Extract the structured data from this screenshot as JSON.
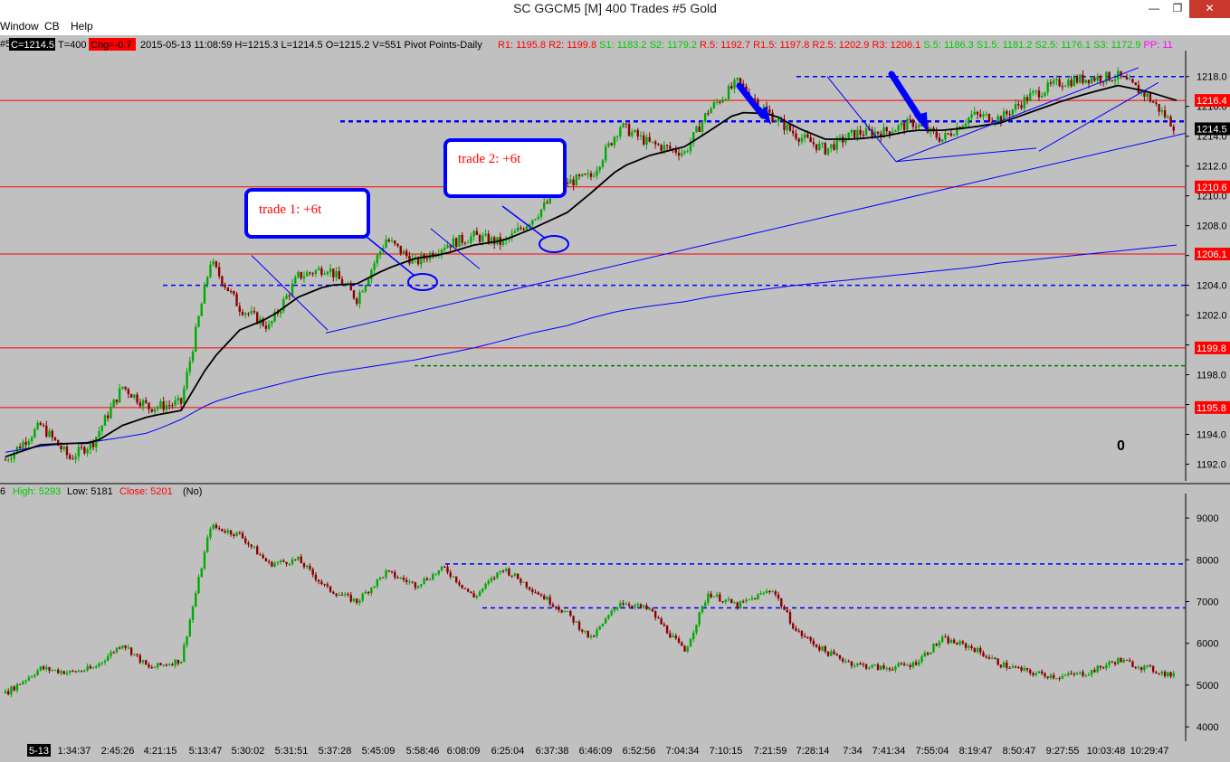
{
  "window": {
    "title": "SC GGCM5 [M]  400 Trades  #5  Gold",
    "minimize_glyph": "—",
    "restore_glyph": "❐",
    "close_glyph": "✕"
  },
  "menu": {
    "items": [
      "Window",
      "CB",
      "Help"
    ]
  },
  "info_bar": {
    "chart_no": "#5",
    "last_box": "C=1214.5",
    "trades": "T=400",
    "change_box": "Chg=-0.7",
    "bar_text": "2015-05-13 11:08:59 H=1215.3 L=1214.5 O=1215.2 V=551 Pivot Points-Daily",
    "pivots": [
      {
        "text": "R1: 1195.8",
        "color": "#ff0000"
      },
      {
        "text": "R2: 1199.8",
        "color": "#ff0000"
      },
      {
        "text": "S1: 1183.2",
        "color": "#00cc00"
      },
      {
        "text": "S2: 1179.2",
        "color": "#00cc00"
      },
      {
        "text": "R.5: 1192.7",
        "color": "#ff0000"
      },
      {
        "text": "R1.5: 1197.8",
        "color": "#ff0000"
      },
      {
        "text": "R2.5: 1202.9",
        "color": "#ff0000"
      },
      {
        "text": "R3: 1206.1",
        "color": "#ff0000"
      },
      {
        "text": "S.5: 1186.3",
        "color": "#00cc00"
      },
      {
        "text": "S1.5: 1181.2",
        "color": "#00cc00"
      },
      {
        "text": "S2.5: 1176.1",
        "color": "#00cc00"
      },
      {
        "text": "S3: 1172.9",
        "color": "#00cc00"
      },
      {
        "text": "PP: 11",
        "color": "#ff00ff"
      }
    ]
  },
  "colors": {
    "background": "#c0c0c0",
    "up_candle": "#00aa00",
    "down_candle": "#8b0000",
    "level_line": "#ff0000",
    "dashed_blue": "#0000ff",
    "ma_line": "#000000",
    "slow_ma": "#0000ff",
    "annotation_border": "#0000ff",
    "annotation_text": "#ff0000"
  },
  "annotations": {
    "trade1": "trade 1: +6t",
    "trade2": "trade 2: +6t",
    "counter": "0"
  },
  "lower_panel": {
    "prefix": "6",
    "high_text": "High: 5293",
    "low_text": "Low: 5181",
    "close_text": "Close: 5201",
    "no_text": "(No)"
  },
  "chart_data": [
    {
      "type": "candlestick",
      "name": "GGCM5 400 Trades",
      "ylim": [
        1191,
        1219.5
      ],
      "y_ticks": [
        "1218.0",
        "1216.0",
        "1214.0",
        "1212.0",
        "1210.0",
        "1208.0",
        "1206.0",
        "1204.0",
        "1202.0",
        "1200.0",
        "1198.0",
        "1196.0",
        "1194.0",
        "1192.0"
      ],
      "price_levels": [
        {
          "label": "1216.4",
          "value": 1216.4
        },
        {
          "label": "1210.6",
          "value": 1210.6
        },
        {
          "label": "1206.1",
          "value": 1206.1
        },
        {
          "label": "1199.8",
          "value": 1199.8
        },
        {
          "label": "1195.8",
          "value": 1195.8
        }
      ],
      "current_price": "1214.5",
      "dashed_levels": [
        1218.0,
        1215.0,
        1204.0
      ],
      "green_dashed_level": 1198.6,
      "path_x_index": [
        0,
        12,
        22,
        30,
        40,
        49,
        60,
        70,
        80,
        90,
        100,
        110,
        120,
        130,
        140,
        150,
        160,
        170,
        180,
        192,
        200,
        210,
        220,
        232,
        240,
        250,
        262,
        270,
        280,
        290,
        300,
        310,
        320,
        330,
        340,
        350,
        360,
        370,
        380,
        390,
        400
      ],
      "path_close": [
        1192.3,
        1194.6,
        1192.4,
        1193.5,
        1197.2,
        1195.8,
        1196.1,
        1205.6,
        1202.5,
        1201.2,
        1204.6,
        1205.2,
        1203.1,
        1207.1,
        1205.5,
        1206.7,
        1207.3,
        1206.8,
        1208.5,
        1210.9,
        1211.3,
        1214.7,
        1213.5,
        1212.9,
        1215.7,
        1217.6,
        1215.3,
        1214.1,
        1213.1,
        1214.2,
        1214.3,
        1214.9,
        1213.8,
        1215.4,
        1215.2,
        1216.7,
        1217.6,
        1217.9,
        1218.0,
        1216.7,
        1214.5
      ],
      "fast_ma": [
        1192.5,
        1193.3,
        1193.4,
        1193.4,
        1194.6,
        1195.2,
        1195.6,
        1198.9,
        1201.0,
        1201.8,
        1203.2,
        1204.0,
        1204.1,
        1205.1,
        1205.8,
        1206.1,
        1206.7,
        1207.0,
        1207.8,
        1208.9,
        1210.2,
        1211.9,
        1212.7,
        1213.3,
        1214.3,
        1215.6,
        1215.5,
        1214.6,
        1213.8,
        1213.8,
        1214.0,
        1214.4,
        1214.4,
        1214.6,
        1214.9,
        1215.6,
        1216.3,
        1216.9,
        1217.4,
        1217.0,
        1216.4
      ],
      "slow_ma": [
        1192.8,
        1193.2,
        1193.4,
        1193.5,
        1193.8,
        1194.1,
        1195.0,
        1196.1,
        1196.7,
        1197.2,
        1197.7,
        1198.1,
        1198.4,
        1198.7,
        1199.0,
        1199.4,
        1199.8,
        1200.3,
        1200.8,
        1201.3,
        1201.8,
        1202.3,
        1202.6,
        1202.9,
        1203.2,
        1203.5,
        1203.8,
        1204.0,
        1204.2,
        1204.4,
        1204.6,
        1204.8,
        1205.0,
        1205.2,
        1205.5,
        1205.7,
        1205.9,
        1206.1,
        1206.3,
        1206.5,
        1206.7
      ]
    },
    {
      "type": "candlestick",
      "name": "Lower indicator",
      "ylim": [
        3700,
        9500
      ],
      "y_ticks": [
        "9000",
        "8000",
        "7000",
        "6000",
        "5000",
        "4000"
      ],
      "dashed_levels": [
        7900,
        6850
      ],
      "path_x_index": [
        0,
        12,
        22,
        30,
        40,
        49,
        60,
        70,
        80,
        90,
        100,
        110,
        120,
        130,
        140,
        150,
        160,
        170,
        180,
        192,
        200,
        210,
        220,
        232,
        240,
        250,
        262,
        270,
        280,
        290,
        300,
        310,
        320,
        330,
        340,
        350,
        360,
        370,
        380,
        390,
        400
      ],
      "path_close": [
        4800,
        5400,
        5300,
        5400,
        6000,
        5400,
        5600,
        8800,
        8600,
        7900,
        8000,
        7300,
        7000,
        7700,
        7400,
        7800,
        7100,
        7800,
        7300,
        6700,
        6100,
        7000,
        6800,
        5800,
        7200,
        6900,
        7300,
        6300,
        5800,
        5500,
        5400,
        5500,
        6100,
        5900,
        5500,
        5300,
        5200,
        5300,
        5600,
        5400,
        5200
      ]
    }
  ],
  "time_axis": {
    "date_box": "5-13",
    "labels": [
      "1:34:37",
      "2:45:26",
      "4:21:15",
      "5:13:47",
      "5:30:02",
      "5:31:51",
      "5:37:28",
      "5:45:09",
      "5:58:46",
      "6:08:09",
      "6:25:04",
      "6:37:38",
      "6:46:09",
      "6:52:56",
      "7:04:34",
      "7:10:15",
      "7:21:59",
      "7:28:14",
      "7:34",
      "7:41:34",
      "7:55:04",
      "8:19:47",
      "8:50:47",
      "9:27:55",
      "10:03:48",
      "10:29:47"
    ]
  }
}
